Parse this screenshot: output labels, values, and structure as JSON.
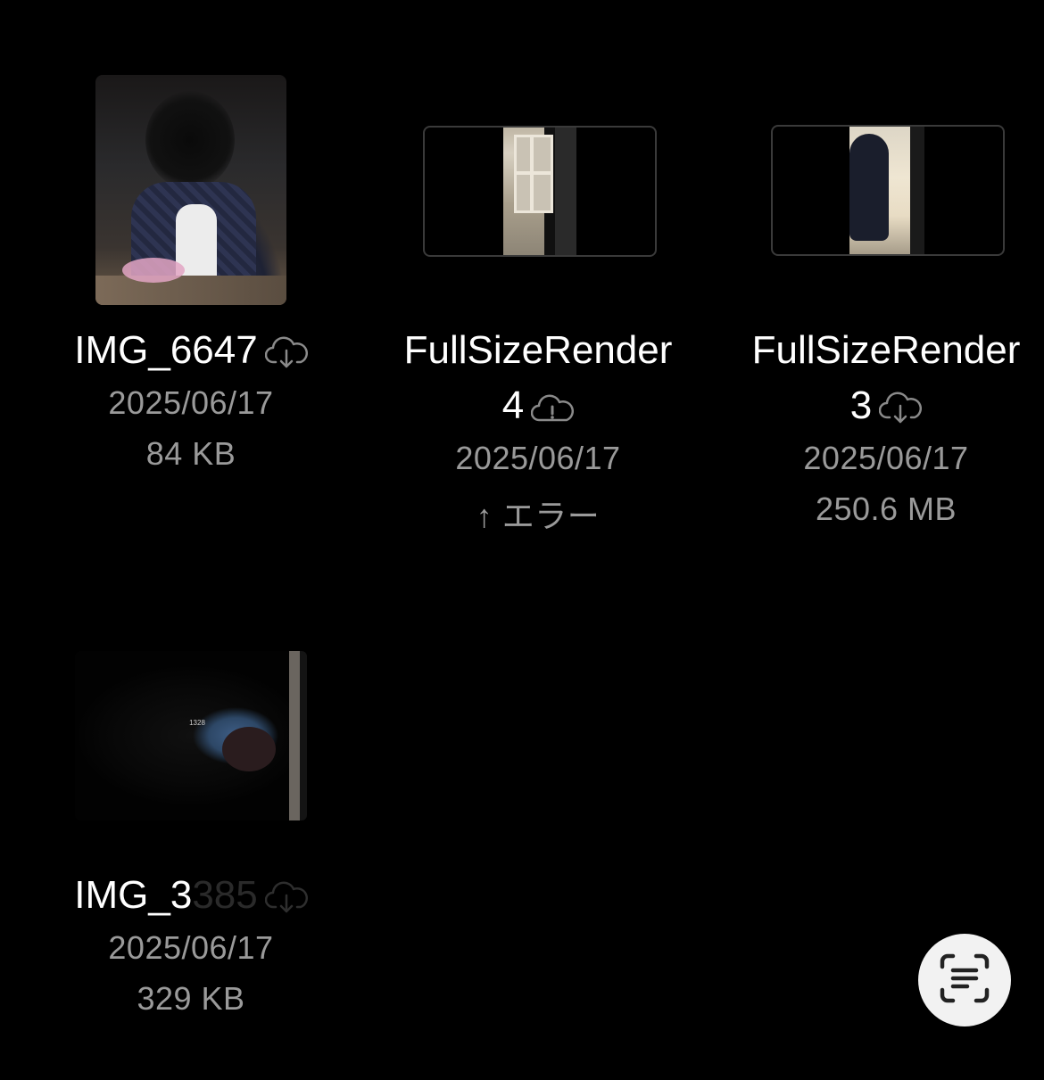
{
  "files": [
    {
      "name": "IMG_6647",
      "date": "2025/06/17",
      "status": "84 KB",
      "icon": "cloud-download-icon"
    },
    {
      "name_line1": "FullSizeRender",
      "name_line2": "4",
      "date": "2025/06/17",
      "status": "↑ エラー",
      "icon": "cloud-error-icon"
    },
    {
      "name_line1": "FullSizeRender",
      "name_line2": "3",
      "date": "2025/06/17",
      "status": "250.6 MB",
      "icon": "cloud-download-icon"
    },
    {
      "name_visible": "IMG_3",
      "name_faded": "385",
      "date": "2025/06/17",
      "status": "329 KB",
      "icon": "cloud-download-icon"
    }
  ],
  "thumb_sign_text": "1328",
  "scan_button": {
    "icon": "scan-text-icon"
  }
}
